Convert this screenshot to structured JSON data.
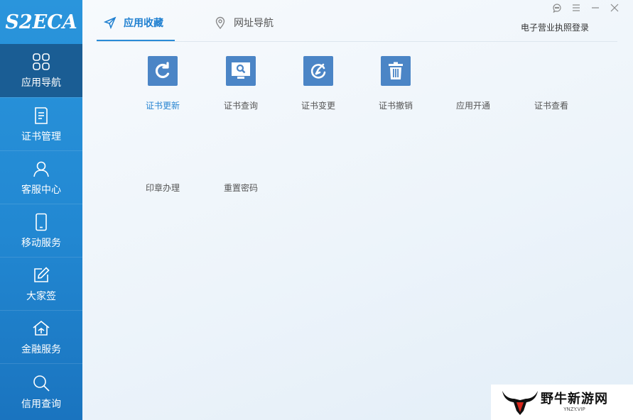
{
  "logo": {
    "text": "S2ECA"
  },
  "sidebar": {
    "items": [
      {
        "label": "应用导航",
        "icon": "grid-icon",
        "active": true
      },
      {
        "label": "证书管理",
        "icon": "document-icon",
        "active": false
      },
      {
        "label": "客服中心",
        "icon": "person-icon",
        "active": false
      },
      {
        "label": "移动服务",
        "icon": "phone-icon",
        "active": false
      },
      {
        "label": "大家签",
        "icon": "edit-icon",
        "active": false
      },
      {
        "label": "金融服务",
        "icon": "bank-icon",
        "active": false
      },
      {
        "label": "信用查询",
        "icon": "search-icon",
        "active": false
      }
    ]
  },
  "tabs": [
    {
      "label": "应用收藏",
      "icon": "send-icon",
      "active": true
    },
    {
      "label": "网址导航",
      "icon": "location-pin-icon",
      "active": false
    }
  ],
  "header": {
    "license_login": "电子营业执照登录"
  },
  "window_controls": [
    "help-icon",
    "menu-icon",
    "minimize-icon",
    "close-icon"
  ],
  "apps": [
    {
      "label": "证书更新",
      "icon": "refresh-icon",
      "highlight": true
    },
    {
      "label": "证书查询",
      "icon": "monitor-search-icon",
      "highlight": false
    },
    {
      "label": "证书变更",
      "icon": "change-icon",
      "highlight": false
    },
    {
      "label": "证书撤销",
      "icon": "trash-icon",
      "highlight": false
    },
    {
      "label": "应用开通",
      "icon": "",
      "highlight": false
    },
    {
      "label": "证书查看",
      "icon": "",
      "highlight": false
    },
    {
      "label": "印章办理",
      "icon": "",
      "highlight": false
    },
    {
      "label": "重置密码",
      "icon": "",
      "highlight": false
    }
  ],
  "watermark": {
    "title": "野牛新游网",
    "sub": "YNZY.VIP"
  },
  "colors": {
    "sidebar": "#2288d2",
    "sidebar_active": "#1a5d94",
    "accent": "#1e7fd0",
    "icon_tile": "#4b85c6"
  }
}
